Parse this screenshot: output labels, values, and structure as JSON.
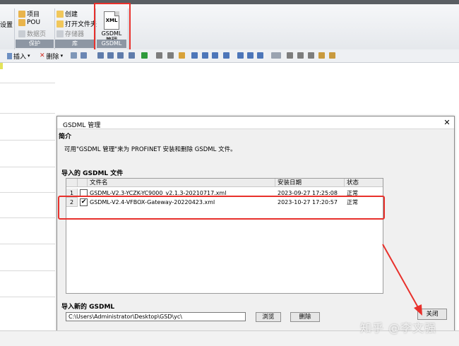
{
  "ribbon": {
    "left_partial": "设置",
    "group_protect": {
      "items": [
        "项目",
        "POU",
        "数据页"
      ],
      "label": "保护"
    },
    "group_library": {
      "items": [
        "创建",
        "打开文件夹",
        "存储器"
      ],
      "label": "库"
    },
    "gsdml": {
      "icon_text": "XML",
      "button_line1": "GSDML",
      "button_line2": "管理",
      "group_label": "GSDML"
    }
  },
  "toolbar": {
    "insert_label": "插入",
    "delete_label": "删除"
  },
  "dialog": {
    "title": "GSDML 管理",
    "close_glyph": "✕",
    "intro_heading": "简介",
    "intro_text": "可用\"GSDML 管理\"来为 PROFINET 安装和删除 GSDML 文件。",
    "imported_heading": "导入的 GSDML 文件",
    "columns": [
      "文件名",
      "安装日期",
      "状态"
    ],
    "rows": [
      {
        "num": "1",
        "checked": false,
        "filename": "GSDML-V2.3-YCZK-YC9000_v2.1.3-20210717.xml",
        "date": "2023-09-27 17:25:08",
        "status": "正常"
      },
      {
        "num": "2",
        "checked": true,
        "filename": "GSDML-V2.4-VFBOX-Gateway-20220423.xml",
        "date": "2023-10-27 17:20:57",
        "status": "正常"
      }
    ],
    "new_heading": "导入新的 GSDML",
    "path_value": "C:\\Users\\Administrator\\Desktop\\GSD\\yc\\",
    "browse_label": "浏览",
    "delete_label": "删除",
    "close_button_label": "关闭"
  },
  "watermark": "知乎 @李文强",
  "colors": {
    "annotation_red": "#e8302b",
    "ribbon_group_label_bg": "#8d96a3"
  }
}
